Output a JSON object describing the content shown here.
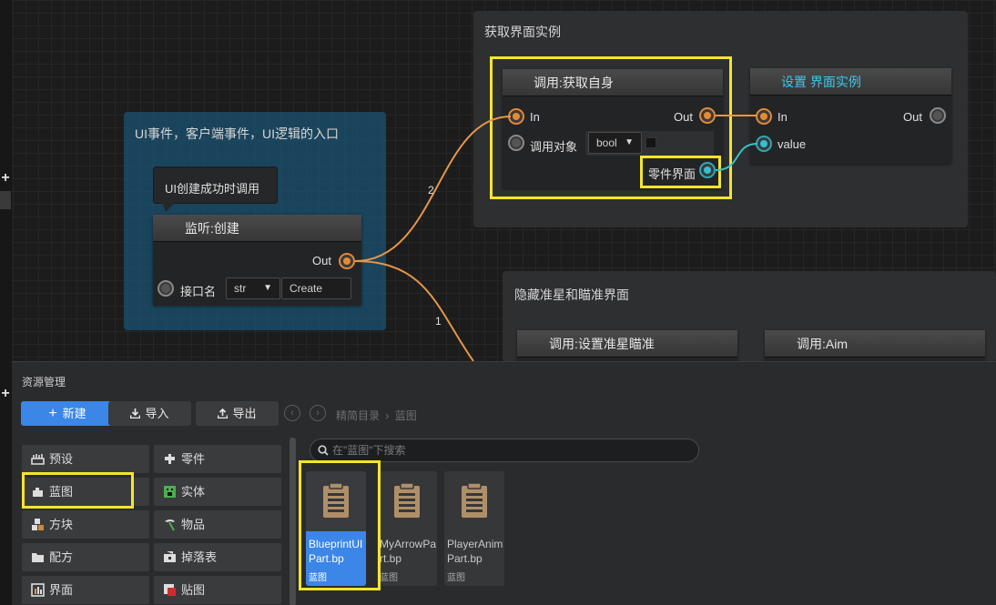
{
  "graph": {
    "groups": {
      "ui_event": {
        "title": "UI事件，客户端事件，UI逻辑的入口"
      },
      "get_instance": {
        "title": "获取界面实例"
      },
      "hide_crosshair": {
        "title": "隐藏准星和瞄准界面"
      }
    },
    "tooltip": "UI创建成功时调用",
    "listen_node": {
      "title": "监听:创建",
      "out_label": "Out",
      "iface_label": "接口名",
      "type_value": "str",
      "name_value": "Create"
    },
    "call_self_node": {
      "title": "调用:获取自身",
      "in_label": "In",
      "out_label": "Out",
      "target_label": "调用对象",
      "type_value": "bool",
      "output_label": "零件界面"
    },
    "set_instance_node": {
      "title": "设置 界面实例",
      "in_label": "In",
      "out_label": "Out",
      "value_label": "value"
    },
    "set_crosshair_node": {
      "title": "调用:设置准星瞄准"
    },
    "call_aim_node": {
      "title": "调用:Aim"
    },
    "link_labels": {
      "first": "2",
      "second": "1"
    },
    "colors": {
      "exec_wire": "#e5954a",
      "data_wire": "#39c1c9",
      "highlight": "#f5e52b"
    },
    "edge_plus": "+"
  },
  "asset_panel": {
    "title": "资源管理",
    "buttons": {
      "new": "新建",
      "import": "导入",
      "export": "导出"
    },
    "breadcrumb": {
      "root": "精简目录",
      "separator": "›",
      "current": "蓝图"
    },
    "search_placeholder": "在\"蓝图\"下搜索",
    "categories": [
      {
        "label": "预设",
        "icon": "preset-icon"
      },
      {
        "label": "零件",
        "icon": "part-icon"
      },
      {
        "label": "蓝图",
        "icon": "blueprint-icon"
      },
      {
        "label": "实体",
        "icon": "entity-icon"
      },
      {
        "label": "方块",
        "icon": "block-icon"
      },
      {
        "label": "物品",
        "icon": "item-icon"
      },
      {
        "label": "配方",
        "icon": "recipe-icon"
      },
      {
        "label": "掉落表",
        "icon": "loot-table-icon"
      },
      {
        "label": "界面",
        "icon": "ui-icon"
      },
      {
        "label": "贴图",
        "icon": "texture-icon"
      }
    ],
    "assets": [
      {
        "name": "BlueprintUIPart.bp",
        "kind": "蓝图",
        "selected": true
      },
      {
        "name": "MyArrowPart.bp",
        "kind": "蓝图",
        "selected": false
      },
      {
        "name": "PlayerAnimPart.bp",
        "kind": "蓝图",
        "selected": false
      }
    ]
  }
}
